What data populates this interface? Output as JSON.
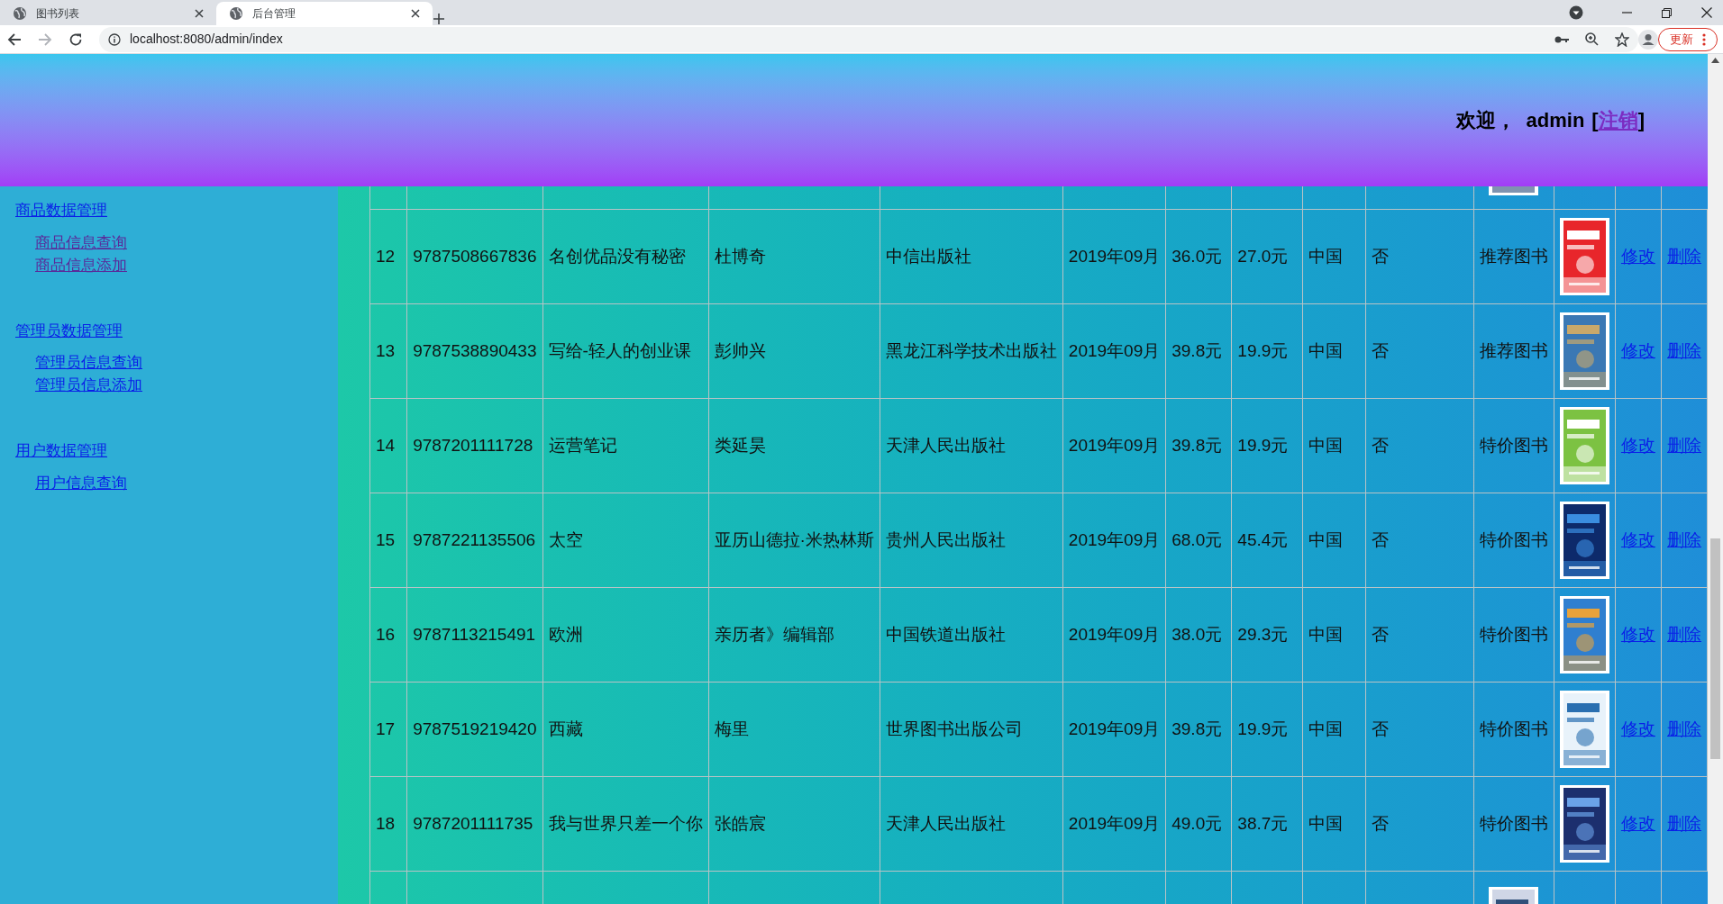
{
  "browser": {
    "tabs": [
      {
        "title": "图书列表",
        "selected": false
      },
      {
        "title": "后台管理",
        "selected": true
      }
    ],
    "url": "localhost:8080/admin/index",
    "update_button": "更新"
  },
  "header": {
    "welcome": "欢迎，",
    "user": "admin",
    "bracket_open": "[",
    "logout": "注销",
    "bracket_close": "]"
  },
  "sidebar": {
    "groups": [
      {
        "title": "商品数据管理",
        "items": [
          {
            "label": "商品信息查询",
            "visited": true
          },
          {
            "label": "商品信息添加",
            "visited": true
          }
        ]
      },
      {
        "title": "管理员数据管理",
        "items": [
          {
            "label": "管理员信息查询",
            "visited": false
          },
          {
            "label": "管理员信息添加",
            "visited": false
          }
        ]
      },
      {
        "title": "用户数据管理",
        "items": [
          {
            "label": "用户信息查询",
            "visited": false
          }
        ]
      }
    ]
  },
  "table": {
    "rows": [
      {
        "id": "12",
        "isbn": "9787508667836",
        "title": "名创优品没有秘密",
        "author": "杜博奇",
        "publisher": "中信出版社",
        "date": "2019年09月",
        "price": "36.0元",
        "sale_price": "27.0元",
        "country": "中国",
        "flag": "否",
        "category": "推荐图书",
        "edit": "修改",
        "delete": "删除"
      },
      {
        "id": "13",
        "isbn": "9787538890433",
        "title": "写给-轻人的创业课",
        "author": "彭帅兴",
        "publisher": "黑龙江科学技术出版社",
        "date": "2019年09月",
        "price": "39.8元",
        "sale_price": "19.9元",
        "country": "中国",
        "flag": "否",
        "category": "推荐图书",
        "edit": "修改",
        "delete": "删除"
      },
      {
        "id": "14",
        "isbn": "9787201111728",
        "title": "运营笔记",
        "author": "类延昊",
        "publisher": "天津人民出版社",
        "date": "2019年09月",
        "price": "39.8元",
        "sale_price": "19.9元",
        "country": "中国",
        "flag": "否",
        "category": "特价图书",
        "edit": "修改",
        "delete": "删除"
      },
      {
        "id": "15",
        "isbn": "9787221135506",
        "title": "太空",
        "author": "亚历山德拉·米热林斯",
        "publisher": "贵州人民出版社",
        "date": "2019年09月",
        "price": "68.0元",
        "sale_price": "45.4元",
        "country": "中国",
        "flag": "否",
        "category": "特价图书",
        "edit": "修改",
        "delete": "删除"
      },
      {
        "id": "16",
        "isbn": "9787113215491",
        "title": "欧洲",
        "author": "亲历者》编辑部",
        "publisher": "中国铁道出版社",
        "date": "2019年09月",
        "price": "38.0元",
        "sale_price": "29.3元",
        "country": "中国",
        "flag": "否",
        "category": "特价图书",
        "edit": "修改",
        "delete": "删除"
      },
      {
        "id": "17",
        "isbn": "9787519219420",
        "title": "西藏",
        "author": "梅里",
        "publisher": "世界图书出版公司",
        "date": "2019年09月",
        "price": "39.8元",
        "sale_price": "19.9元",
        "country": "中国",
        "flag": "否",
        "category": "特价图书",
        "edit": "修改",
        "delete": "删除"
      },
      {
        "id": "18",
        "isbn": "9787201111735",
        "title": "我与世界只差一个你",
        "author": "张皓宸",
        "publisher": "天津人民出版社",
        "date": "2019年09月",
        "price": "49.0元",
        "sale_price": "38.7元",
        "country": "中国",
        "flag": "否",
        "category": "特价图书",
        "edit": "修改",
        "delete": "删除"
      }
    ]
  }
}
